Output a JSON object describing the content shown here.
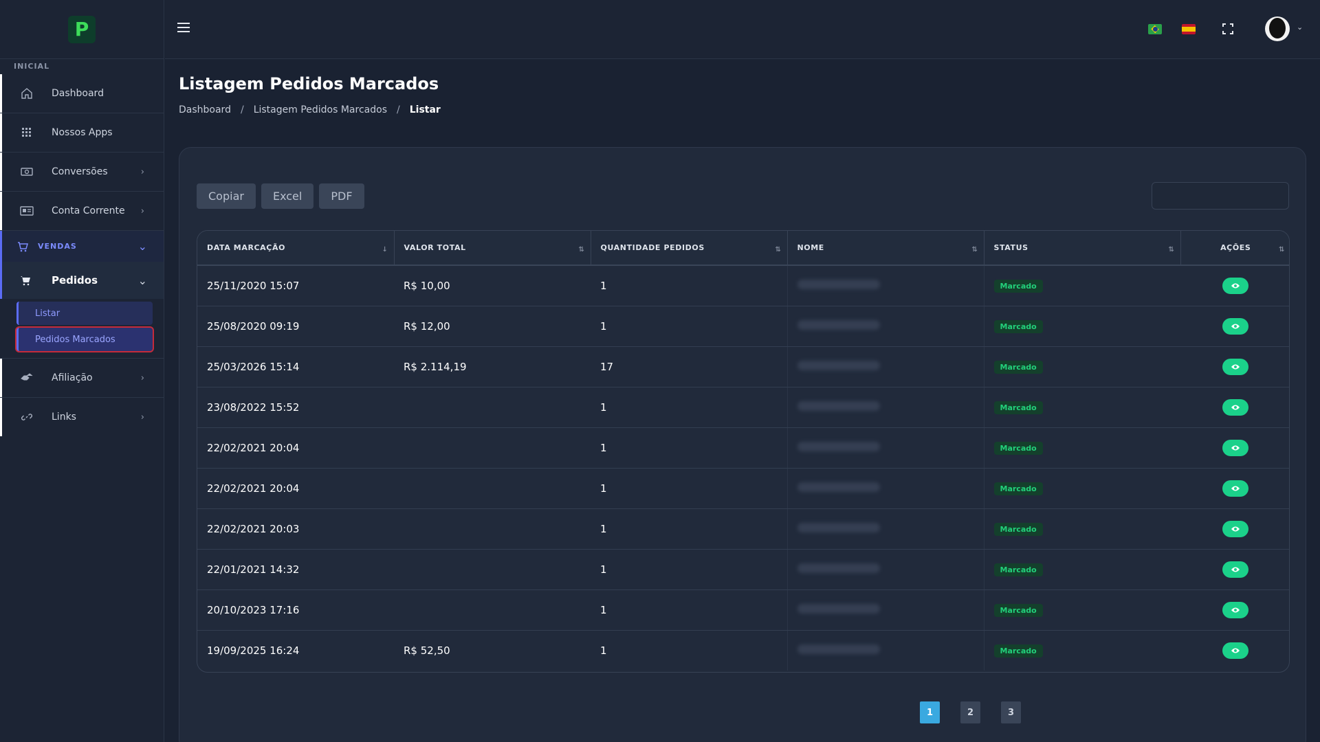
{
  "sidebar": {
    "section_inicial": "INICIAL",
    "items": [
      {
        "label": "Dashboard",
        "icon": "home-icon"
      },
      {
        "label": "Nossos Apps",
        "icon": "grid-icon"
      },
      {
        "label": "Conversões",
        "icon": "money-icon"
      },
      {
        "label": "Conta Corrente",
        "icon": "id-card-icon"
      }
    ],
    "vendas_label": "VENDAS",
    "pedidos_label": "Pedidos",
    "sub_listar": "Listar",
    "sub_marcados": "Pedidos Marcados",
    "afiliacao_label": "Afiliação",
    "links_label": "Links"
  },
  "header": {
    "title": "Listagem Pedidos Marcados",
    "breadcrumb": [
      "Dashboard",
      "Listagem Pedidos Marcados",
      "Listar"
    ]
  },
  "toolbar": {
    "copy": "Copiar",
    "excel": "Excel",
    "pdf": "PDF"
  },
  "table": {
    "columns": [
      "DATA MARCAÇÃO",
      "VALOR TOTAL",
      "QUANTIDADE PEDIDOS",
      "NOME",
      "STATUS",
      "AÇÕES"
    ],
    "rows": [
      {
        "date": "25/11/2020 15:07",
        "value": "R$ 10,00",
        "qty": "1",
        "status": "Marcado"
      },
      {
        "date": "25/08/2020 09:19",
        "value": "R$ 12,00",
        "qty": "1",
        "status": "Marcado"
      },
      {
        "date": "25/03/2026 15:14",
        "value": "R$ 2.114,19",
        "qty": "17",
        "status": "Marcado"
      },
      {
        "date": "23/08/2022 15:52",
        "value": "",
        "qty": "1",
        "status": "Marcado"
      },
      {
        "date": "22/02/2021 20:04",
        "value": "",
        "qty": "1",
        "status": "Marcado"
      },
      {
        "date": "22/02/2021 20:04",
        "value": "",
        "qty": "1",
        "status": "Marcado"
      },
      {
        "date": "22/02/2021 20:03",
        "value": "",
        "qty": "1",
        "status": "Marcado"
      },
      {
        "date": "22/01/2021 14:32",
        "value": "",
        "qty": "1",
        "status": "Marcado"
      },
      {
        "date": "20/10/2023 17:16",
        "value": "",
        "qty": "1",
        "status": "Marcado"
      },
      {
        "date": "19/09/2025 16:24",
        "value": "R$ 52,50",
        "qty": "1",
        "status": "Marcado"
      }
    ]
  },
  "pagination": [
    "1",
    "2",
    "3"
  ],
  "colors": {
    "accent": "#5b6cf5",
    "success": "#1bd18a",
    "page_active": "#3aa9e0"
  }
}
